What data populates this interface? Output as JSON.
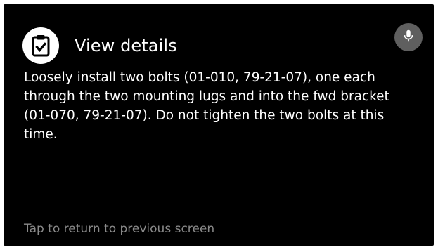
{
  "header": {
    "title": "View details",
    "app_icon": "clipboard-check-icon"
  },
  "mic_button": {
    "icon": "microphone-icon"
  },
  "content": {
    "text": "Loosely install two bolts (01-010, 79-21-07), one each through the two mounting lugs and into the fwd bracket (01-070, 79-21-07). Do not tighten the two bolts at this time."
  },
  "footer": {
    "hint": "Tap to return to previous screen"
  },
  "colors": {
    "background": "#000000",
    "text": "#ffffff",
    "hint": "#8a8a8a",
    "mic_button": "#5f5f5f"
  }
}
